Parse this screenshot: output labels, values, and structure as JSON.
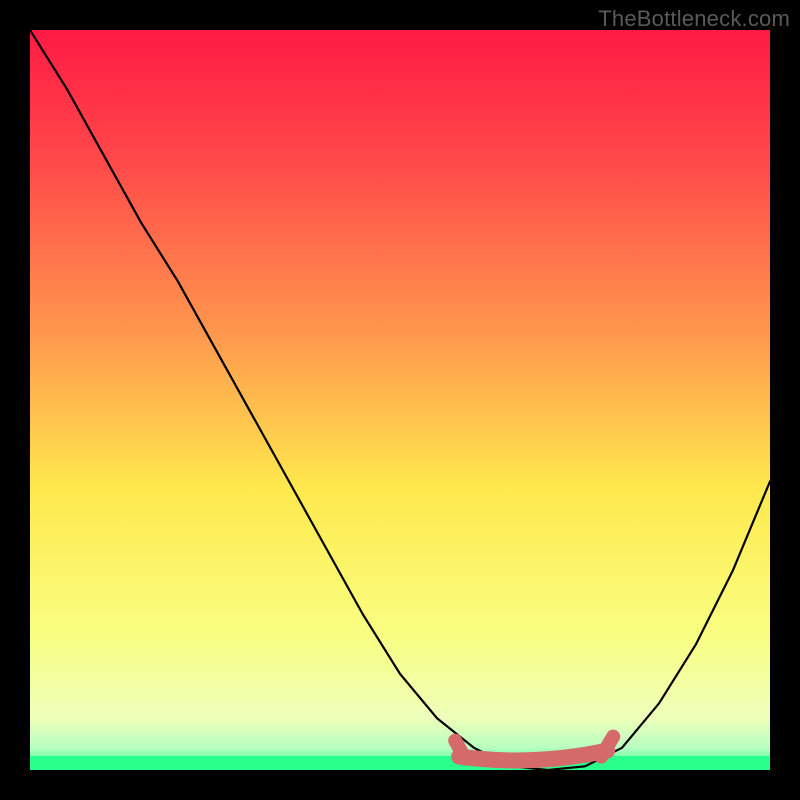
{
  "watermark": "TheBottleneck.com",
  "chart_data": {
    "type": "line",
    "title": "",
    "xlabel": "",
    "ylabel": "",
    "xlim": [
      0,
      1
    ],
    "ylim": [
      0,
      1
    ],
    "grid": false,
    "legend": false,
    "background_gradient": {
      "top": "#ff1a44",
      "upper_mid": "#ff944d",
      "mid": "#ffe94d",
      "lower_mid": "#f5ff9a",
      "bottom_line": "#2aff8c"
    },
    "series": [
      {
        "name": "curve",
        "stroke": "#000000",
        "x": [
          0.0,
          0.05,
          0.1,
          0.15,
          0.2,
          0.25,
          0.3,
          0.35,
          0.4,
          0.45,
          0.5,
          0.55,
          0.6,
          0.65,
          0.7,
          0.75,
          0.8,
          0.85,
          0.9,
          0.95,
          1.0
        ],
        "y": [
          1.0,
          0.92,
          0.83,
          0.74,
          0.66,
          0.57,
          0.48,
          0.39,
          0.3,
          0.21,
          0.13,
          0.07,
          0.03,
          0.005,
          0.0,
          0.005,
          0.03,
          0.09,
          0.17,
          0.27,
          0.39
        ]
      }
    ],
    "highlight": {
      "name": "bottom-band",
      "stroke": "#d46a6a",
      "x_range": [
        0.58,
        0.78
      ],
      "y_level": 0.01
    }
  }
}
